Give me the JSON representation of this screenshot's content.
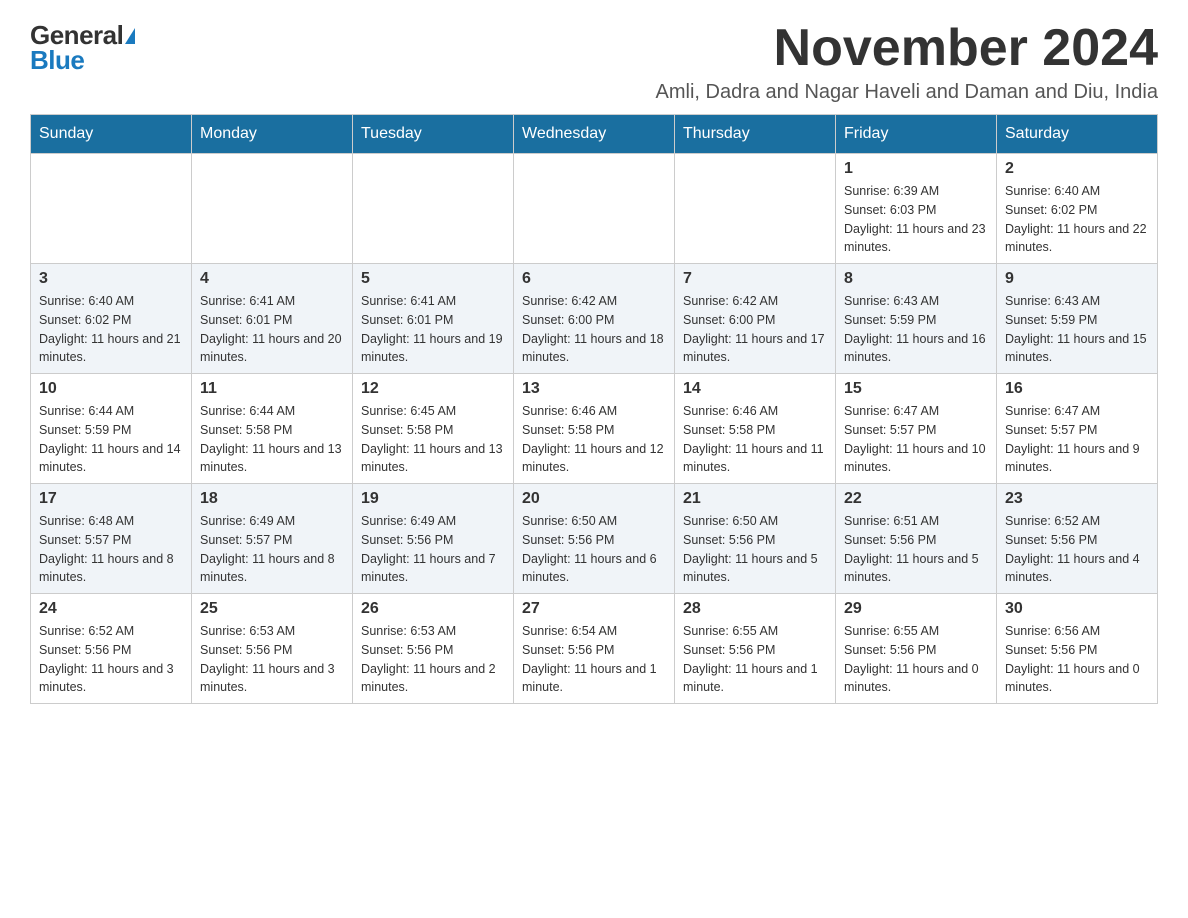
{
  "logo": {
    "general": "General",
    "blue": "Blue"
  },
  "title": "November 2024",
  "subtitle": "Amli, Dadra and Nagar Haveli and Daman and Diu, India",
  "weekdays": [
    "Sunday",
    "Monday",
    "Tuesday",
    "Wednesday",
    "Thursday",
    "Friday",
    "Saturday"
  ],
  "weeks": [
    [
      {
        "day": "",
        "info": ""
      },
      {
        "day": "",
        "info": ""
      },
      {
        "day": "",
        "info": ""
      },
      {
        "day": "",
        "info": ""
      },
      {
        "day": "",
        "info": ""
      },
      {
        "day": "1",
        "info": "Sunrise: 6:39 AM\nSunset: 6:03 PM\nDaylight: 11 hours and 23 minutes."
      },
      {
        "day": "2",
        "info": "Sunrise: 6:40 AM\nSunset: 6:02 PM\nDaylight: 11 hours and 22 minutes."
      }
    ],
    [
      {
        "day": "3",
        "info": "Sunrise: 6:40 AM\nSunset: 6:02 PM\nDaylight: 11 hours and 21 minutes."
      },
      {
        "day": "4",
        "info": "Sunrise: 6:41 AM\nSunset: 6:01 PM\nDaylight: 11 hours and 20 minutes."
      },
      {
        "day": "5",
        "info": "Sunrise: 6:41 AM\nSunset: 6:01 PM\nDaylight: 11 hours and 19 minutes."
      },
      {
        "day": "6",
        "info": "Sunrise: 6:42 AM\nSunset: 6:00 PM\nDaylight: 11 hours and 18 minutes."
      },
      {
        "day": "7",
        "info": "Sunrise: 6:42 AM\nSunset: 6:00 PM\nDaylight: 11 hours and 17 minutes."
      },
      {
        "day": "8",
        "info": "Sunrise: 6:43 AM\nSunset: 5:59 PM\nDaylight: 11 hours and 16 minutes."
      },
      {
        "day": "9",
        "info": "Sunrise: 6:43 AM\nSunset: 5:59 PM\nDaylight: 11 hours and 15 minutes."
      }
    ],
    [
      {
        "day": "10",
        "info": "Sunrise: 6:44 AM\nSunset: 5:59 PM\nDaylight: 11 hours and 14 minutes."
      },
      {
        "day": "11",
        "info": "Sunrise: 6:44 AM\nSunset: 5:58 PM\nDaylight: 11 hours and 13 minutes."
      },
      {
        "day": "12",
        "info": "Sunrise: 6:45 AM\nSunset: 5:58 PM\nDaylight: 11 hours and 13 minutes."
      },
      {
        "day": "13",
        "info": "Sunrise: 6:46 AM\nSunset: 5:58 PM\nDaylight: 11 hours and 12 minutes."
      },
      {
        "day": "14",
        "info": "Sunrise: 6:46 AM\nSunset: 5:58 PM\nDaylight: 11 hours and 11 minutes."
      },
      {
        "day": "15",
        "info": "Sunrise: 6:47 AM\nSunset: 5:57 PM\nDaylight: 11 hours and 10 minutes."
      },
      {
        "day": "16",
        "info": "Sunrise: 6:47 AM\nSunset: 5:57 PM\nDaylight: 11 hours and 9 minutes."
      }
    ],
    [
      {
        "day": "17",
        "info": "Sunrise: 6:48 AM\nSunset: 5:57 PM\nDaylight: 11 hours and 8 minutes."
      },
      {
        "day": "18",
        "info": "Sunrise: 6:49 AM\nSunset: 5:57 PM\nDaylight: 11 hours and 8 minutes."
      },
      {
        "day": "19",
        "info": "Sunrise: 6:49 AM\nSunset: 5:56 PM\nDaylight: 11 hours and 7 minutes."
      },
      {
        "day": "20",
        "info": "Sunrise: 6:50 AM\nSunset: 5:56 PM\nDaylight: 11 hours and 6 minutes."
      },
      {
        "day": "21",
        "info": "Sunrise: 6:50 AM\nSunset: 5:56 PM\nDaylight: 11 hours and 5 minutes."
      },
      {
        "day": "22",
        "info": "Sunrise: 6:51 AM\nSunset: 5:56 PM\nDaylight: 11 hours and 5 minutes."
      },
      {
        "day": "23",
        "info": "Sunrise: 6:52 AM\nSunset: 5:56 PM\nDaylight: 11 hours and 4 minutes."
      }
    ],
    [
      {
        "day": "24",
        "info": "Sunrise: 6:52 AM\nSunset: 5:56 PM\nDaylight: 11 hours and 3 minutes."
      },
      {
        "day": "25",
        "info": "Sunrise: 6:53 AM\nSunset: 5:56 PM\nDaylight: 11 hours and 3 minutes."
      },
      {
        "day": "26",
        "info": "Sunrise: 6:53 AM\nSunset: 5:56 PM\nDaylight: 11 hours and 2 minutes."
      },
      {
        "day": "27",
        "info": "Sunrise: 6:54 AM\nSunset: 5:56 PM\nDaylight: 11 hours and 1 minute."
      },
      {
        "day": "28",
        "info": "Sunrise: 6:55 AM\nSunset: 5:56 PM\nDaylight: 11 hours and 1 minute."
      },
      {
        "day": "29",
        "info": "Sunrise: 6:55 AM\nSunset: 5:56 PM\nDaylight: 11 hours and 0 minutes."
      },
      {
        "day": "30",
        "info": "Sunrise: 6:56 AM\nSunset: 5:56 PM\nDaylight: 11 hours and 0 minutes."
      }
    ]
  ]
}
